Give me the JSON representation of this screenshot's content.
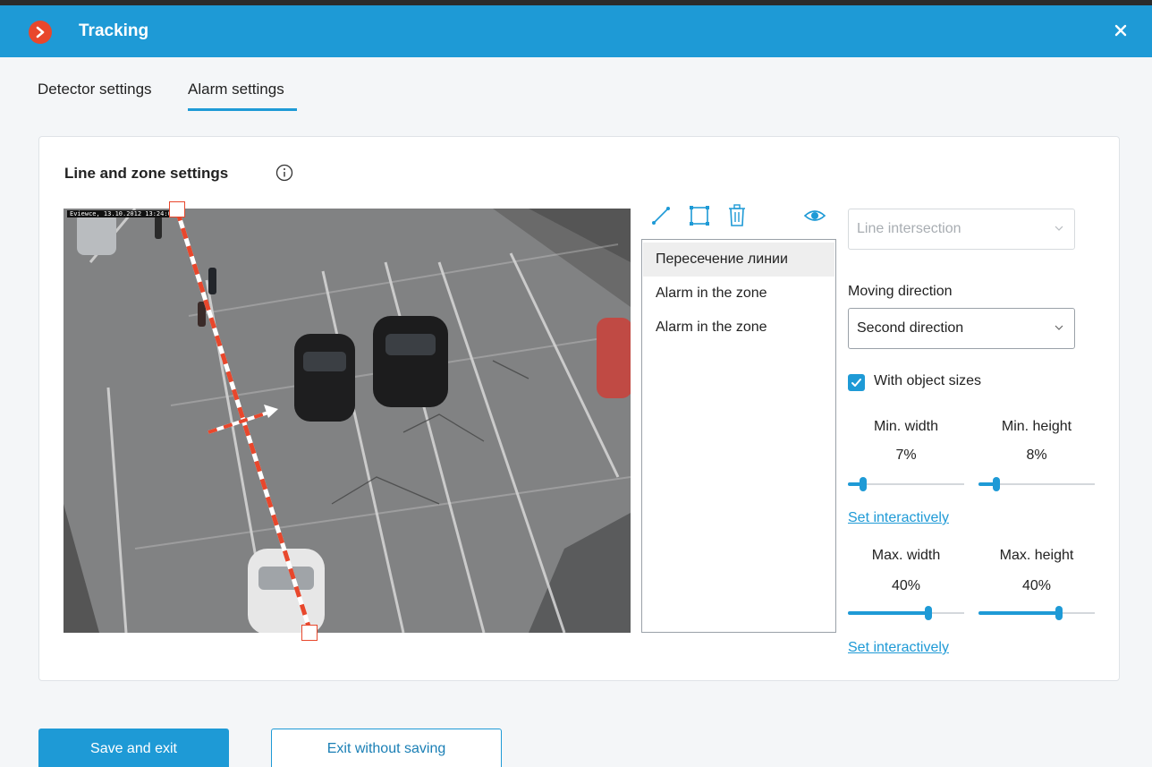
{
  "window": {
    "title": "Tracking",
    "logo_icon": "app-logo-icon",
    "close_icon": "close-icon"
  },
  "tabs": [
    {
      "label": "Detector settings",
      "active": false
    },
    {
      "label": "Alarm settings",
      "active": true
    }
  ],
  "panel": {
    "title": "Line and zone settings",
    "video": {
      "timestamp": "Eviewce, 13.10.2012 13:24:07"
    },
    "tools": [
      "line-tool-icon",
      "zone-tool-icon",
      "delete-icon",
      "visibility-icon"
    ],
    "rules": [
      {
        "label": "Пересечение линии",
        "selected": true
      },
      {
        "label": "Alarm in the zone",
        "selected": false
      },
      {
        "label": "Alarm in the zone",
        "selected": false
      }
    ],
    "settings": {
      "rule_type": {
        "value": "Line intersection",
        "disabled": true
      },
      "moving_direction": {
        "label": "Moving direction",
        "value": "Second direction"
      },
      "with_object_sizes": {
        "label": "With object sizes",
        "checked": true
      },
      "min_width": {
        "label": "Min. width",
        "value": "7%",
        "fraction": 0.07
      },
      "min_height": {
        "label": "Min. height",
        "value": "8%",
        "fraction": 0.08
      },
      "set_interactively_1": "Set interactively",
      "max_width": {
        "label": "Max. width",
        "value": "40%",
        "fraction": 0.4
      },
      "max_height": {
        "label": "Max. height",
        "value": "40%",
        "fraction": 0.4
      },
      "set_interactively_2": "Set interactively"
    }
  },
  "buttons": {
    "save": "Save and exit",
    "exit": "Exit without saving"
  },
  "colors": {
    "accent": "#1e9ad6",
    "brand": "#e8472c",
    "line": "#e8472c"
  }
}
